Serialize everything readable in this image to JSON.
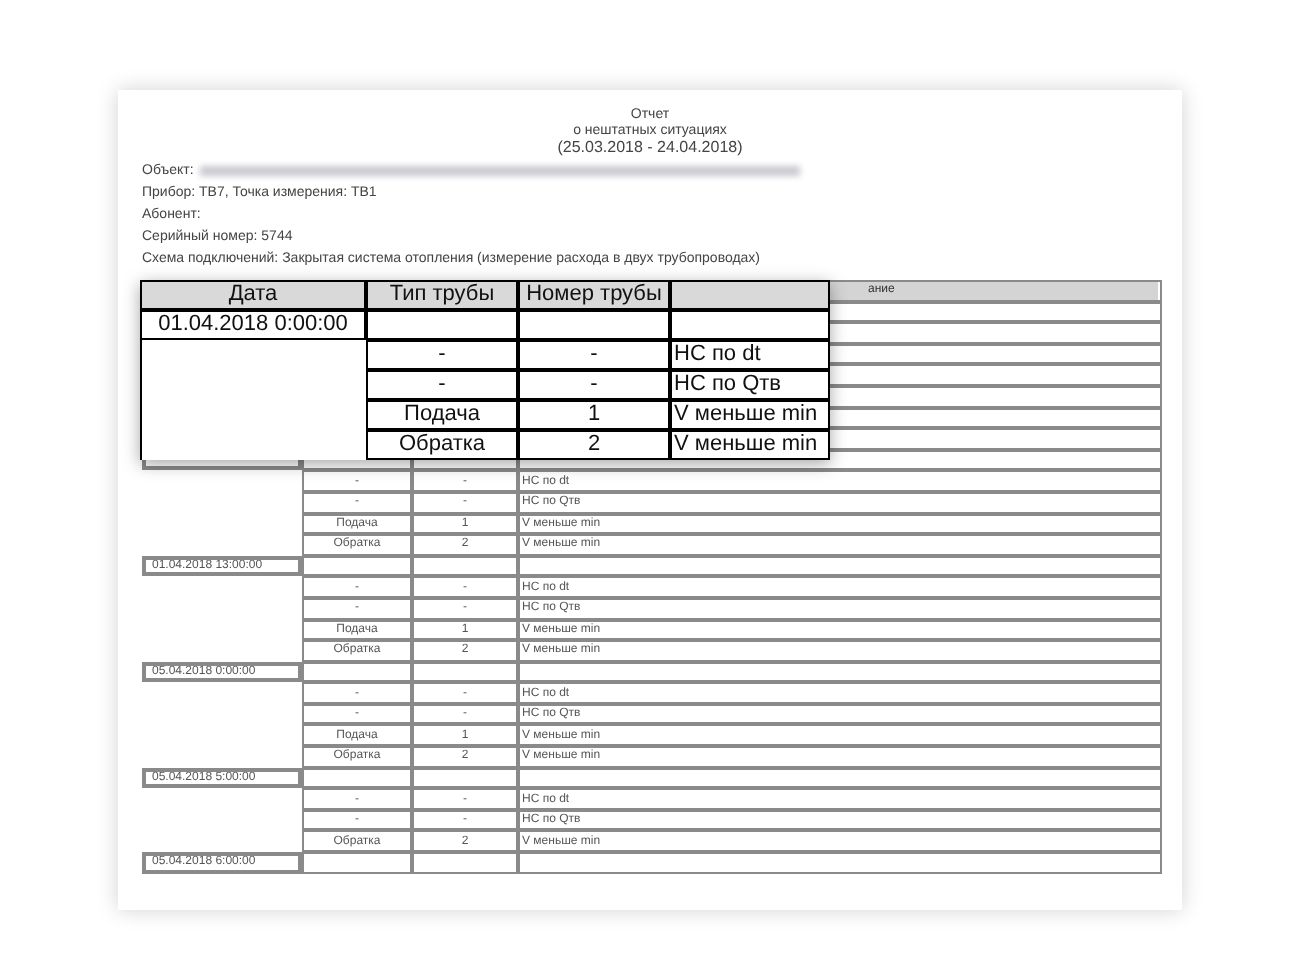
{
  "report": {
    "title": "Отчет",
    "subtitle": "о нештатных ситуациях",
    "period": "(25.03.2018 - 24.04.2018)",
    "fields": [
      {
        "text": "Объект:",
        "redacted": true
      },
      {
        "text": "Прибор: ТВ7, Точка измерения: ТВ1",
        "redacted": false
      },
      {
        "text": "Абонент:",
        "redacted": false
      },
      {
        "text": "Серийный номер: 5744",
        "redacted": false
      },
      {
        "text": "Схема подключений: Закрытая система отопления (измерение расхода в двух трубопроводах)",
        "redacted": false
      }
    ]
  },
  "document_table": {
    "column_4": "ание",
    "groups": [
      {
        "events": [
          {
            "pipe": "-",
            "number": "-",
            "description": "НС по dt"
          },
          {
            "pipe": "-",
            "number": "-",
            "description": "НС по Qтв"
          },
          {
            "pipe": "Подача",
            "number": "1",
            "description": "V меньше min"
          },
          {
            "pipe": "Обратка",
            "number": "2",
            "description": "V меньше min"
          }
        ]
      },
      {
        "date": "01.04.2018 13:00:00",
        "events": [
          {
            "pipe": "-",
            "number": "-",
            "description": "НС по dt"
          },
          {
            "pipe": "-",
            "number": "-",
            "description": "НС по Qтв"
          },
          {
            "pipe": "Подача",
            "number": "1",
            "description": "V меньше min"
          },
          {
            "pipe": "Обратка",
            "number": "2",
            "description": "V меньше min"
          }
        ]
      },
      {
        "date": "05.04.2018 0:00:00",
        "events": [
          {
            "pipe": "-",
            "number": "-",
            "description": "НС по dt"
          },
          {
            "pipe": "-",
            "number": "-",
            "description": "НС по Qтв"
          },
          {
            "pipe": "Подача",
            "number": "1",
            "description": "V меньше min"
          },
          {
            "pipe": "Обратка",
            "number": "2",
            "description": "V меньше min"
          }
        ]
      },
      {
        "date": "05.04.2018 5:00:00",
        "events": [
          {
            "pipe": "-",
            "number": "-",
            "description": "НС по dt"
          },
          {
            "pipe": "-",
            "number": "-",
            "description": "НС по Qтв"
          },
          {
            "pipe": "Обратка",
            "number": "2",
            "description": "V меньше min"
          }
        ]
      },
      {
        "date": "05.04.2018 6:00:00"
      }
    ]
  },
  "zoom_table": {
    "columns": [
      "Дата",
      "Тип трубы",
      "Номер трубы"
    ],
    "date": "01.04.2018 0:00:00",
    "events": [
      {
        "pipe": "-",
        "number": "-",
        "description": "НС по dt"
      },
      {
        "pipe": "-",
        "number": "-",
        "description": "НС по Qтв"
      },
      {
        "pipe": "Подача",
        "number": "1",
        "description": "V меньше min"
      },
      {
        "pipe": "Обратка",
        "number": "2",
        "description": "V меньше min"
      }
    ]
  }
}
